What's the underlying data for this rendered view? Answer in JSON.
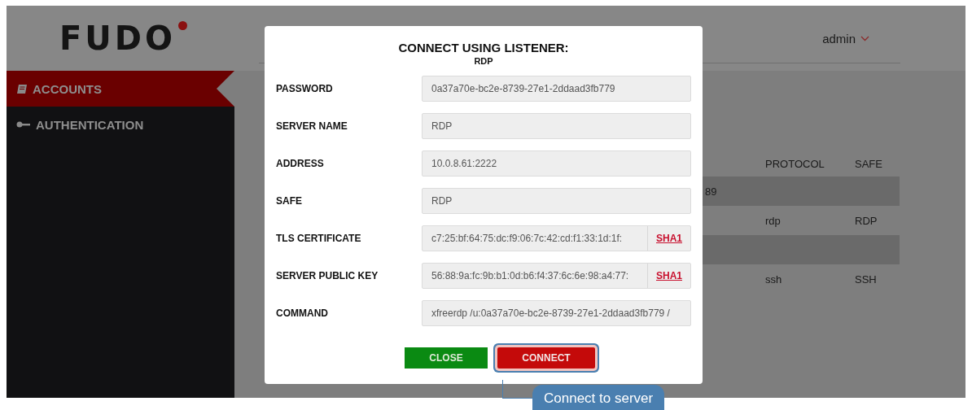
{
  "header": {
    "logo": "FUDO",
    "user_menu": "admin"
  },
  "sidebar": {
    "items": [
      {
        "label": "ACCOUNTS",
        "kind": "book",
        "selected": true
      },
      {
        "label": "AUTHENTICATION",
        "kind": "key",
        "selected": false
      }
    ]
  },
  "table": {
    "columns": [
      "",
      "PROTOCOL",
      "SAFE"
    ],
    "rows": [
      {
        "cells": [
          "89",
          "",
          ""
        ],
        "shaded": true
      },
      {
        "cells": [
          "",
          "rdp",
          "RDP"
        ],
        "shaded": false
      },
      {
        "cells": [
          "",
          "",
          ""
        ],
        "shaded": true
      },
      {
        "cells": [
          "",
          "ssh",
          "SSH"
        ],
        "shaded": false
      }
    ]
  },
  "dialog": {
    "title": "CONNECT USING LISTENER:",
    "subtitle": "RDP",
    "fields": [
      {
        "label": "PASSWORD",
        "value": "0a37a70e-bc2e-8739-27e1-2ddaad3fb779"
      },
      {
        "label": "SERVER NAME",
        "value": "RDP"
      },
      {
        "label": "ADDRESS",
        "value": "10.0.8.61:2222"
      },
      {
        "label": "SAFE",
        "value": "RDP"
      },
      {
        "label": "TLS CERTIFICATE",
        "value": "c7:25:bf:64:75:dc:f9:06:7c:42:cd:f1:33:1d:1f:",
        "hash_link": "SHA1"
      },
      {
        "label": "SERVER PUBLIC KEY",
        "value": "56:88:9a:fc:9b:b1:0d:b6:f4:37:6c:6e:98:a4:77:",
        "hash_link": "SHA1"
      },
      {
        "label": "COMMAND",
        "value": "xfreerdp /u:0a37a70e-bc2e-8739-27e1-2ddaad3fb779 /"
      }
    ],
    "buttons": [
      {
        "label": "CLOSE",
        "kind": "close",
        "highlighted": false
      },
      {
        "label": "CONNECT",
        "kind": "connect",
        "highlighted": true
      }
    ]
  },
  "callout": {
    "text": "Connect to server"
  }
}
